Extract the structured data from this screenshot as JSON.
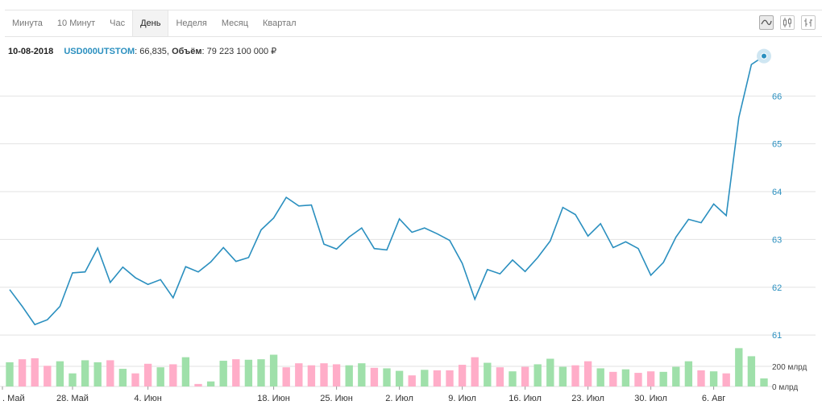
{
  "tabs": [
    {
      "label": "Минута",
      "active": false
    },
    {
      "label": "10 Минут",
      "active": false
    },
    {
      "label": "Час",
      "active": false
    },
    {
      "label": "День",
      "active": true
    },
    {
      "label": "Неделя",
      "active": false
    },
    {
      "label": "Месяц",
      "active": false
    },
    {
      "label": "Квартал",
      "active": false
    }
  ],
  "tools": [
    {
      "icon": "line-chart-icon",
      "active": true
    },
    {
      "icon": "candlestick-icon",
      "active": false
    },
    {
      "icon": "ohlc-bars-icon",
      "active": false
    }
  ],
  "info": {
    "date": "10-08-2018",
    "ticker": "USD000UTSTOM",
    "value": ": 66,835,",
    "volume_label": "Объём",
    "volume_value": ": 79 223 100 000 ₽"
  },
  "colors": {
    "line": "#2a8fbf",
    "vol_up": "#9fe0aa",
    "vol_down": "#ffadc8",
    "grid": "#e2e2e2",
    "axis_text": "#2a8fbf"
  },
  "chart_data": {
    "type": "line",
    "title": "",
    "ylabel": "",
    "ylim": [
      60.8,
      67.2
    ],
    "y_ticks": [
      "61",
      "62",
      "63",
      "64",
      "65",
      "66"
    ],
    "x_tick_labels": [
      ". Май",
      "28. Май",
      "4. Июн",
      "18. Июн",
      "25. Июн",
      "2. Июл",
      "9. Июл",
      "16. Июл",
      "23. Июл",
      "30. Июл",
      "6. Авг"
    ],
    "price": [
      61.95,
      61.6,
      61.22,
      61.32,
      61.6,
      62.3,
      62.32,
      62.82,
      62.1,
      62.42,
      62.2,
      62.06,
      62.16,
      61.78,
      62.43,
      62.32,
      62.53,
      62.83,
      62.54,
      62.62,
      63.2,
      63.45,
      63.88,
      63.7,
      63.72,
      62.9,
      62.8,
      63.05,
      63.24,
      62.81,
      62.78,
      63.43,
      63.15,
      63.24,
      63.12,
      62.98,
      62.5,
      61.75,
      62.37,
      62.28,
      62.57,
      62.33,
      62.62,
      62.97,
      63.67,
      63.52,
      63.07,
      63.33,
      62.83,
      62.95,
      62.81,
      62.25,
      62.52,
      63.05,
      63.42,
      63.35,
      63.74,
      63.5,
      65.55,
      66.66,
      66.835
    ],
    "volume": {
      "unit": "млрд",
      "ylim": [
        0,
        415
      ],
      "y_ticks": [
        "200 млрд",
        "0 млрд"
      ],
      "values": [
        240,
        270,
        280,
        205,
        250,
        130,
        260,
        240,
        260,
        175,
        130,
        225,
        190,
        220,
        290,
        25,
        50,
        255,
        270,
        265,
        270,
        315,
        190,
        230,
        210,
        230,
        220,
        210,
        230,
        185,
        180,
        155,
        110,
        165,
        160,
        160,
        215,
        290,
        235,
        190,
        150,
        195,
        220,
        275,
        195,
        210,
        250,
        180,
        145,
        170,
        135,
        150,
        145,
        195,
        250,
        160,
        150,
        130,
        380,
        300,
        80
      ],
      "direction": [
        "up",
        "down",
        "down",
        "down",
        "up",
        "up",
        "up",
        "up",
        "down",
        "up",
        "down",
        "down",
        "up",
        "down",
        "up",
        "down",
        "up",
        "up",
        "down",
        "up",
        "up",
        "up",
        "down",
        "down",
        "down",
        "down",
        "down",
        "up",
        "up",
        "down",
        "up",
        "up",
        "down",
        "up",
        "down",
        "down",
        "down",
        "down",
        "up",
        "down",
        "up",
        "down",
        "up",
        "up",
        "up",
        "down",
        "down",
        "up",
        "down",
        "up",
        "down",
        "down",
        "up",
        "up",
        "up",
        "down",
        "up",
        "down",
        "up",
        "up",
        "up"
      ]
    }
  }
}
